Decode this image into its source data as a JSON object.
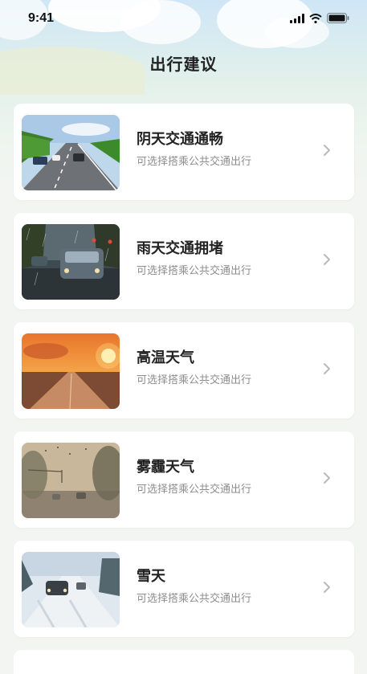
{
  "status_bar": {
    "time": "9:41"
  },
  "header": {
    "title": "出行建议"
  },
  "cards": [
    {
      "title": "阴天交通通畅",
      "subtitle": "可选择搭乘公共交通出行",
      "image": "overcast-highway-image"
    },
    {
      "title": "雨天交通拥堵",
      "subtitle": "可选择搭乘公共交通出行",
      "image": "rainy-traffic-image"
    },
    {
      "title": "高温天气",
      "subtitle": "可选择搭乘公共交通出行",
      "image": "hot-road-sunset-image"
    },
    {
      "title": "雾霾天气",
      "subtitle": "可选择搭乘公共交通出行",
      "image": "smog-street-image"
    },
    {
      "title": "雪天",
      "subtitle": "可选择搭乘公共交通出行",
      "image": "snowy-road-image"
    }
  ]
}
